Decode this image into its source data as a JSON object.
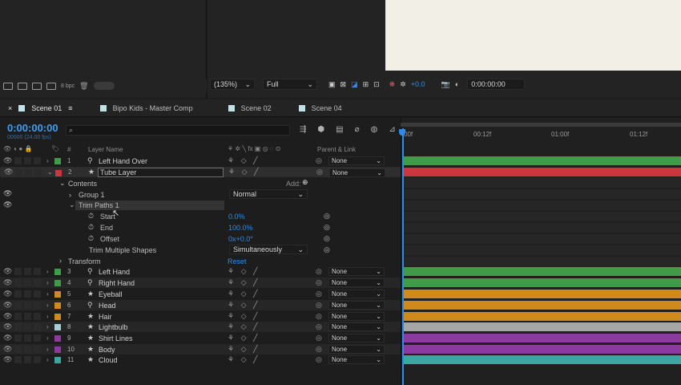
{
  "project_bar": {
    "bpc": "8 bpc"
  },
  "viewer": {
    "zoom": "(135%)",
    "resolution": "Full",
    "exposure": "+0.0",
    "timecode": "0:00:00:00"
  },
  "tabs": [
    {
      "label": "Scene 01",
      "active": true
    },
    {
      "label": "Bipo Kids - Master Comp",
      "active": false
    },
    {
      "label": "Scene 02",
      "active": false
    },
    {
      "label": "Scene 04",
      "active": false
    }
  ],
  "comp": {
    "timecode": "0:00:00:00",
    "fps": "00000 (24.00 fps)",
    "search_placeholder": ""
  },
  "columns": {
    "hash": "#",
    "layer_name": "Layer Name",
    "parent": "Parent & Link"
  },
  "timeline_ticks": [
    "00f",
    "00:12f",
    "01:00f",
    "01:12f"
  ],
  "layers": [
    {
      "num": "1",
      "name": "Left Hand Over",
      "color": "#3f9b48",
      "icon": "puppet",
      "parent": "None"
    },
    {
      "num": "2",
      "name": "Tube Layer",
      "color": "#c8383e",
      "icon": "star",
      "parent": "None"
    },
    {
      "num": "3",
      "name": "Left Hand",
      "color": "#3f9b48",
      "icon": "puppet",
      "parent": "None"
    },
    {
      "num": "4",
      "name": "Right Hand",
      "color": "#3f9b48",
      "icon": "puppet",
      "parent": "None"
    },
    {
      "num": "5",
      "name": "Eyeball",
      "color": "#d08a1b",
      "icon": "star",
      "parent": "None"
    },
    {
      "num": "6",
      "name": "Head",
      "color": "#d08a1b",
      "icon": "puppet",
      "parent": "None"
    },
    {
      "num": "7",
      "name": "Hair",
      "color": "#d08a1b",
      "icon": "star",
      "parent": "None"
    },
    {
      "num": "8",
      "name": "Lightbulb",
      "color": "#a6ced3",
      "icon": "star",
      "parent": "None"
    },
    {
      "num": "9",
      "name": "Shirt Lines",
      "color": "#8b3ba0",
      "icon": "star",
      "parent": "None"
    },
    {
      "num": "10",
      "name": "Body",
      "color": "#8b3ba0",
      "icon": "star",
      "parent": "None"
    },
    {
      "num": "11",
      "name": "Cloud",
      "color": "#3aa7a0",
      "icon": "star",
      "parent": "None"
    }
  ],
  "contents": {
    "contents_label": "Contents",
    "add_label": "Add:",
    "group_label": "Group 1",
    "group_mode": "Normal",
    "trim_label": "Trim Paths 1",
    "start_label": "Start",
    "start_value": "0.0%",
    "end_label": "End",
    "end_value": "100.0%",
    "offset_label": "Offset",
    "offset_value": "0x+0.0°",
    "trim_multiple_label": "Trim Multiple Shapes",
    "trim_multiple_value": "Simultaneously",
    "transform_label": "Transform",
    "reset_label": "Reset"
  },
  "bar_colors": [
    "#3f9b48",
    "#c8383e",
    "#3f9b48",
    "#3f9b48",
    "#d08a1b",
    "#d08a1b",
    "#d08a1b",
    "#a6a6a6",
    "#8b3ba0",
    "#8b3ba0",
    "#3aa7a0"
  ]
}
